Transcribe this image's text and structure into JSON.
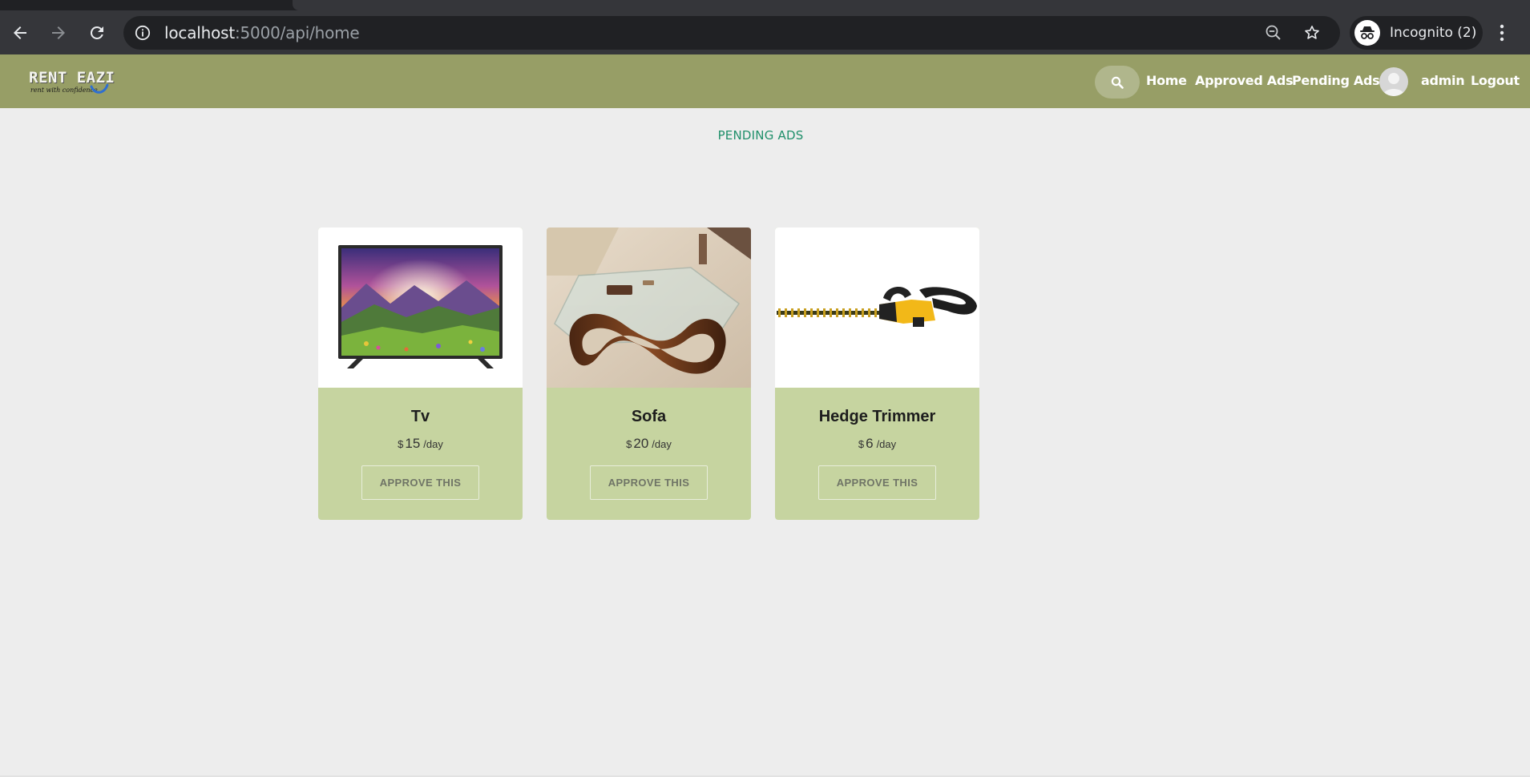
{
  "browser": {
    "url_host": "localhost",
    "url_rest": ":5000/api/home",
    "profile_label": "Incognito (2)",
    "icons": [
      "back-arrow-icon",
      "forward-arrow-icon",
      "reload-icon",
      "info-icon",
      "zoom-out-icon",
      "star-icon",
      "incognito-icon",
      "kebab-menu-icon"
    ]
  },
  "header": {
    "logo_title": "RENT EAZI",
    "logo_tagline": "rent with confidence",
    "nav": {
      "home": "Home",
      "approved": "Approved Ads",
      "pending": "Pending Ads",
      "username": "admin",
      "logout": "Logout"
    },
    "colors": {
      "bar": "#979e66",
      "search_pill": "#b0b68c"
    }
  },
  "main": {
    "title": "PENDING ADS",
    "title_color": "#1f8f6a",
    "cards": [
      {
        "title": "Tv",
        "currency": "$",
        "price": "15",
        "unit": "/day",
        "action": "APPROVE THIS",
        "image": "tv-image"
      },
      {
        "title": "Sofa",
        "currency": "$",
        "price": "20",
        "unit": "/day",
        "action": "APPROVE THIS",
        "image": "glass-table-image"
      },
      {
        "title": "Hedge Trimmer",
        "currency": "$",
        "price": "6",
        "unit": "/day",
        "action": "APPROVE THIS",
        "image": "hedge-trimmer-image"
      }
    ],
    "card_color": "#c6d4a0"
  }
}
